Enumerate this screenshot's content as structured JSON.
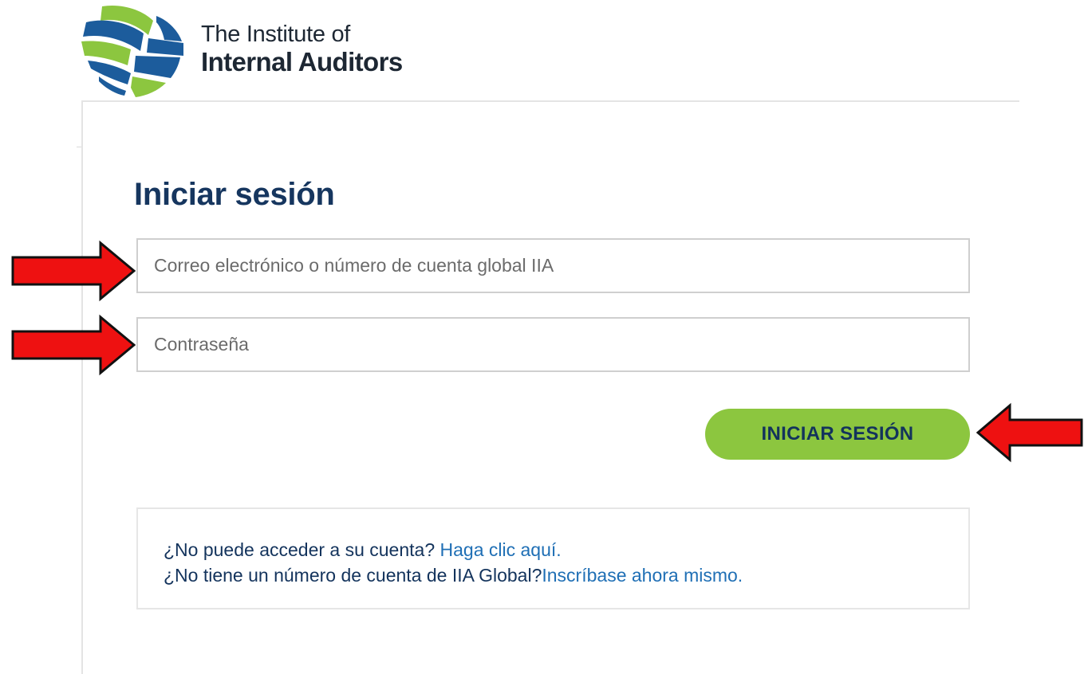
{
  "brand": {
    "line1": "The Institute of",
    "line2": "Internal Auditors",
    "colors": {
      "blue": "#1c5c9c",
      "green": "#8cc63f"
    }
  },
  "login": {
    "title": "Iniciar sesión",
    "email_placeholder": "Correo electrónico o número de cuenta global IIA",
    "password_placeholder": "Contraseña",
    "submit_label": "INICIAR SESIÓN",
    "button_color": "#8cc63f",
    "title_color": "#16365f"
  },
  "help": {
    "q1": "¿No puede acceder a su cuenta? ",
    "link1": "Haga clic aquí.",
    "q2": "¿No tiene un número de cuenta de IIA Global?",
    "link2": "Inscríbase ahora mismo.",
    "link_color": "#1f6fb5"
  },
  "annotations": {
    "arrow_color": "#ee1111",
    "arrow_icon": "red-arrow-icon"
  }
}
